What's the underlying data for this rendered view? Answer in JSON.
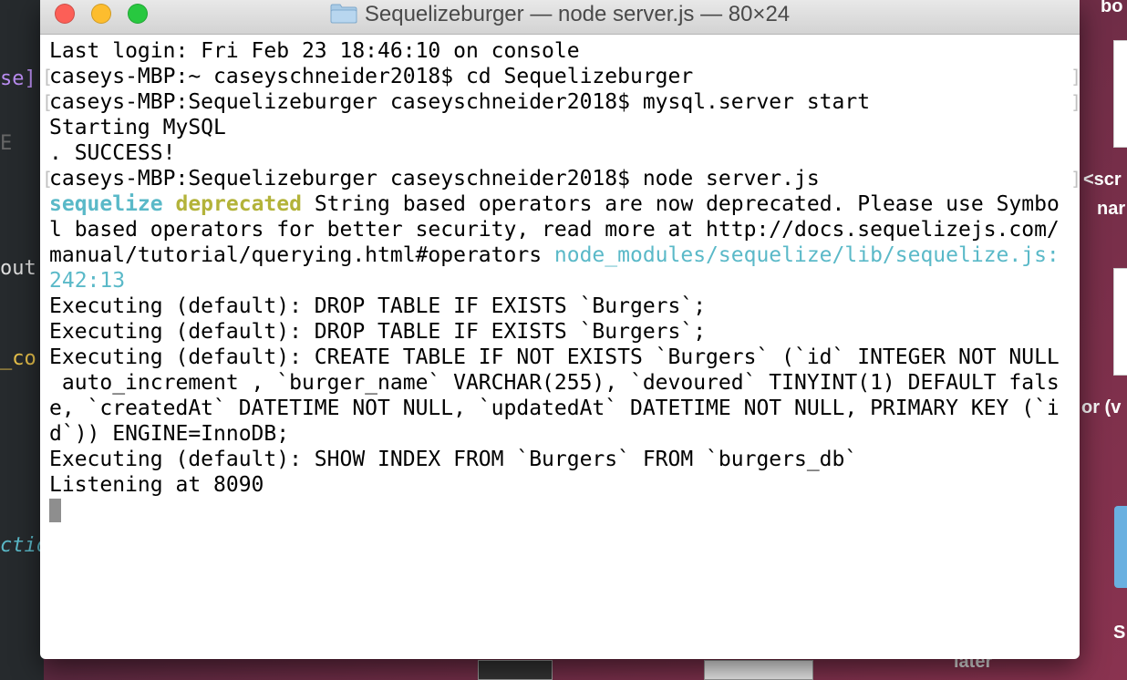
{
  "window": {
    "title": "Sequelizeburger — node server.js — 80×24"
  },
  "editor_fragments": [
    "se]",
    "E",
    "out:",
    "_co",
    "ctio"
  ],
  "desktop_labels": [
    "bo",
    "<scr",
    "nar",
    "or (v",
    "S",
    "later"
  ],
  "terminal": {
    "lines": [
      {
        "segments": [
          {
            "text": "Last login: Fri Feb 23 18:46:10 on console"
          }
        ]
      },
      {
        "segments": [
          {
            "text": "caseys-MBP:~ caseyschneider2018$ cd Sequelizeburger"
          }
        ],
        "brackets": true
      },
      {
        "segments": [
          {
            "text": "caseys-MBP:Sequelizeburger caseyschneider2018$ mysql.server start"
          }
        ],
        "brackets": true
      },
      {
        "segments": [
          {
            "text": "Starting MySQL"
          }
        ]
      },
      {
        "segments": [
          {
            "text": ". SUCCESS!"
          }
        ]
      },
      {
        "segments": [
          {
            "text": "caseys-MBP:Sequelizeburger caseyschneider2018$ node server.js"
          }
        ],
        "brackets": true
      },
      {
        "segments": [
          {
            "text": "sequelize",
            "style": "cyan bold"
          },
          {
            "text": " "
          },
          {
            "text": "deprecated",
            "style": "yellow bold"
          },
          {
            "text": " String based operators are now deprecated. Please use Symbo"
          }
        ]
      },
      {
        "segments": [
          {
            "text": "l based operators for better security, read more at http://docs.sequelizejs.com/"
          }
        ]
      },
      {
        "segments": [
          {
            "text": "manual/tutorial/querying.html#operators "
          },
          {
            "text": "node_modules/sequelize/lib/sequelize.js:",
            "style": "cyan"
          }
        ]
      },
      {
        "segments": [
          {
            "text": "242:13",
            "style": "cyan"
          }
        ]
      },
      {
        "segments": [
          {
            "text": "Executing (default): DROP TABLE IF EXISTS `Burgers`;"
          }
        ]
      },
      {
        "segments": [
          {
            "text": "Executing (default): DROP TABLE IF EXISTS `Burgers`;"
          }
        ]
      },
      {
        "segments": [
          {
            "text": "Executing (default): CREATE TABLE IF NOT EXISTS `Burgers` (`id` INTEGER NOT NULL"
          }
        ]
      },
      {
        "segments": [
          {
            "text": " auto_increment , `burger_name` VARCHAR(255), `devoured` TINYINT(1) DEFAULT fals"
          }
        ]
      },
      {
        "segments": [
          {
            "text": "e, `createdAt` DATETIME NOT NULL, `updatedAt` DATETIME NOT NULL, PRIMARY KEY (`i"
          }
        ]
      },
      {
        "segments": [
          {
            "text": "d`)) ENGINE=InnoDB;"
          }
        ]
      },
      {
        "segments": [
          {
            "text": "Executing (default): SHOW INDEX FROM `Burgers` FROM `burgers_db`"
          }
        ]
      },
      {
        "segments": [
          {
            "text": "Listening at 8090"
          }
        ]
      }
    ]
  },
  "colors": {
    "prompt_text": "#000000",
    "sequelize_cyan": "#5ab9c8",
    "deprecated_yellow": "#b3b33a",
    "cursor": "#8e8e8e"
  }
}
